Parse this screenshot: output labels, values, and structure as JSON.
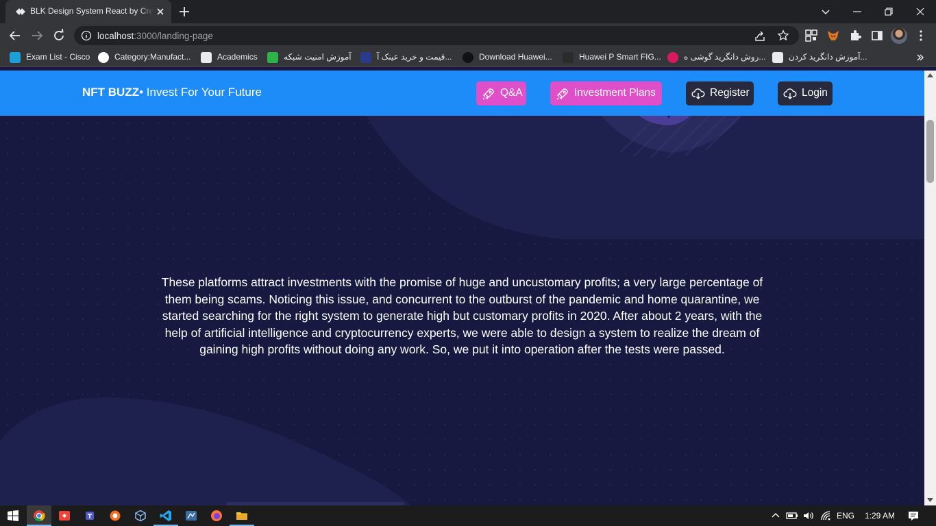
{
  "browser": {
    "tab_title": "BLK Design System React by Creative Tim",
    "url_host": "localhost",
    "url_path": ":3000/landing-page"
  },
  "bookmarks": [
    {
      "label": "Exam List - Cisco",
      "icon": "cisco-icon"
    },
    {
      "label": "Category:Manufact...",
      "icon": "wikipedia-icon"
    },
    {
      "label": "Academics",
      "icon": "academics-icon"
    },
    {
      "label": "آموزش امنیت شبکه",
      "icon": "green-site-icon"
    },
    {
      "label": "قیمت و خرید عینک آ...",
      "icon": "glasses-site-icon"
    },
    {
      "label": "Download Huawei...",
      "icon": "huawei-icon"
    },
    {
      "label": "Huawei P Smart FIG...",
      "icon": "phone-site-icon"
    },
    {
      "label": "روش دانگرید گوشی ه...",
      "icon": "red-site-icon"
    },
    {
      "label": "آموزش دانگرید کردن...",
      "icon": "android-site-icon"
    }
  ],
  "navbar": {
    "brand_bold": "NFT BUZZ",
    "brand_rest": "• Invest For Your Future",
    "buttons": {
      "qa": "Q&A",
      "plans": "Investment Plans",
      "register": "Register",
      "login": "Login"
    }
  },
  "main": {
    "paragraph": "These platforms attract investments with the promise of huge and uncustomary profits; a very large percentage of them being scams. Noticing this issue, and concurrent to the outburst of the pandemic and home quarantine, we started searching for the right system to generate high but customary profits in 2020. After about 2 years, with the help of artificial intelligence and cryptocurrency experts, we were able to design a system to realize the dream of gaining high profits without doing any work. So, we put it into operation after the tests were passed."
  },
  "taskbar": {
    "language": "ENG",
    "time": "1:29 AM"
  },
  "colors": {
    "page_bg": "#171941",
    "navbar_bg": "#1d8cf8",
    "pink_button": "#e14eca",
    "dark_button": "#27293d"
  }
}
